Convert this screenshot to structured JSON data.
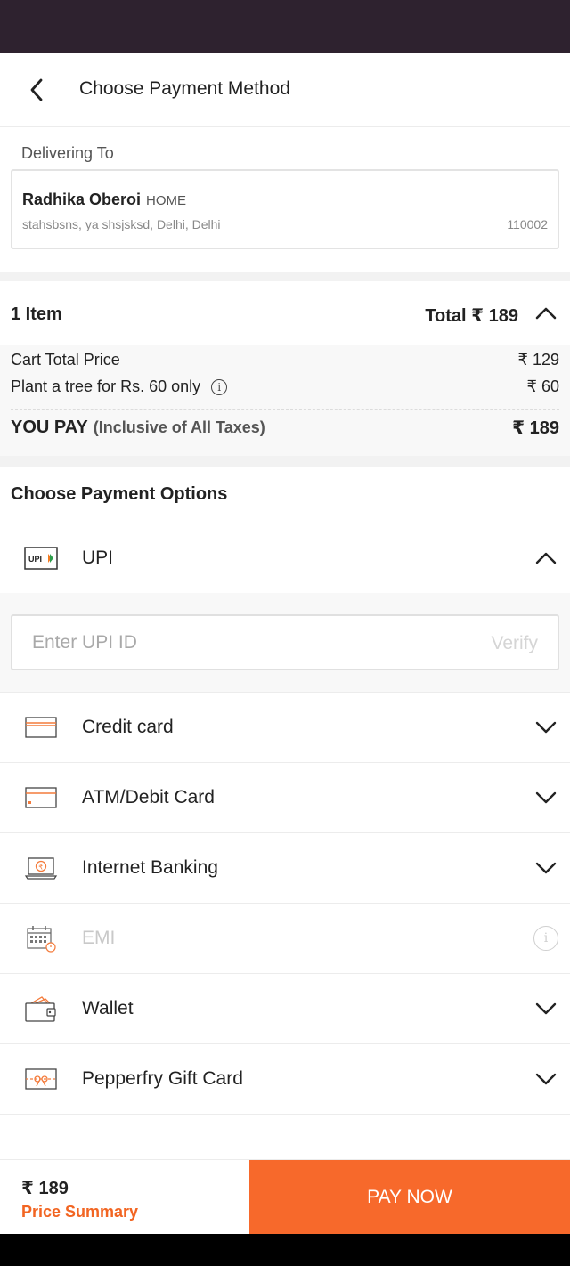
{
  "header": {
    "title": "Choose Payment Method"
  },
  "delivery": {
    "label": "Delivering To",
    "name": "Radhika Oberoi",
    "tag": "HOME",
    "address": "stahsbsns, ya shsjsksd, Delhi, Delhi",
    "pincode": "110002"
  },
  "order": {
    "items_label": "1 Item",
    "total_label": "Total ₹ 189",
    "rows": [
      {
        "label": "Cart Total Price",
        "value": "₹ 129"
      },
      {
        "label": "Plant a tree for Rs. 60 only",
        "value": "₹ 60"
      }
    ],
    "you_pay_label": "YOU PAY",
    "you_pay_note": "(Inclusive of All Taxes)",
    "you_pay_value": "₹ 189"
  },
  "payment": {
    "title": "Choose Payment Options",
    "upi": {
      "label": "UPI",
      "icon_text": "UPI",
      "input_placeholder": "Enter UPI ID",
      "verify_label": "Verify"
    },
    "options": [
      {
        "label": "Credit card",
        "icon": "credit-card-icon",
        "enabled": true
      },
      {
        "label": "ATM/Debit Card",
        "icon": "debit-card-icon",
        "enabled": true
      },
      {
        "label": "Internet Banking",
        "icon": "internet-banking-icon",
        "enabled": true
      },
      {
        "label": "EMI",
        "icon": "emi-calendar-icon",
        "enabled": false
      },
      {
        "label": "Wallet",
        "icon": "wallet-icon",
        "enabled": true
      },
      {
        "label": "Pepperfry Gift Card",
        "icon": "gift-card-icon",
        "enabled": true
      }
    ]
  },
  "footer": {
    "amount": "₹ 189",
    "summary_label": "Price Summary",
    "pay_label": "PAY NOW"
  },
  "colors": {
    "accent": "#f7692b",
    "accent_text": "#f26522",
    "status_bar": "#2e222f"
  }
}
